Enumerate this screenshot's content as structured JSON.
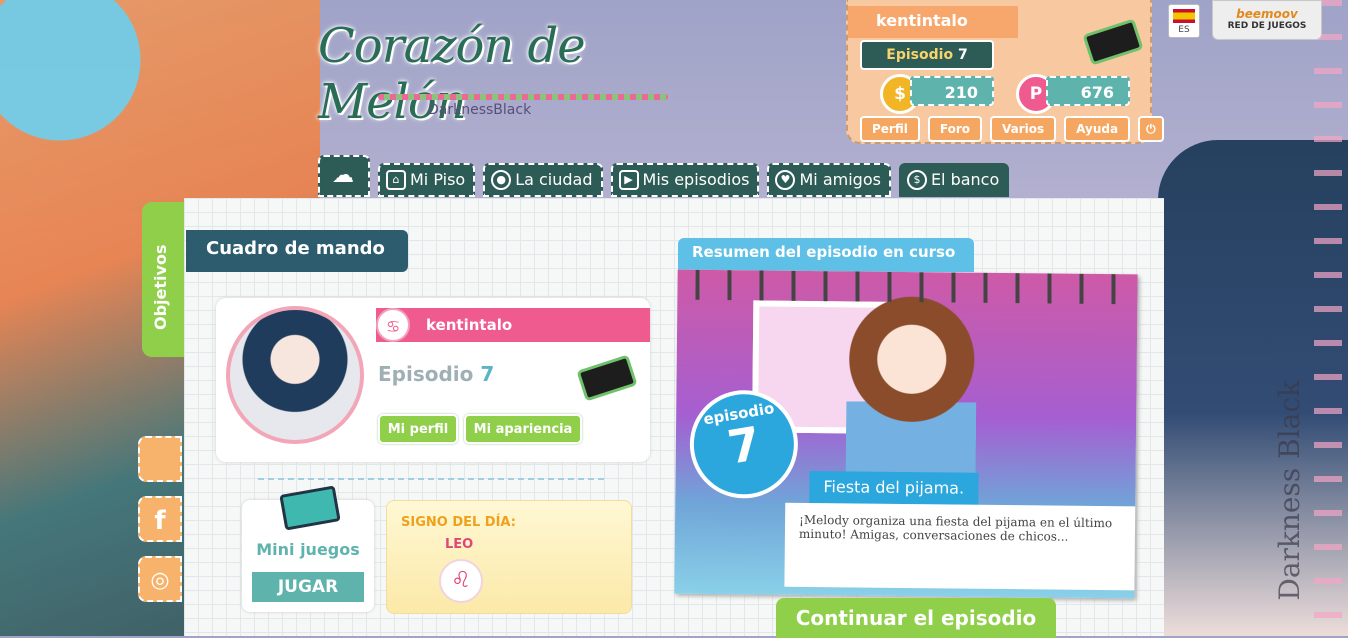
{
  "logo": {
    "title": "Corazón de Melón",
    "subtitle": "DarknessBlack"
  },
  "player": {
    "name": "kentintalo",
    "episode_label": "Episodio",
    "episode_number": "7",
    "coins": "210",
    "pa": "676",
    "links": [
      "Perfil",
      "Foro",
      "Varios",
      "Ayuda"
    ],
    "power_icon": "power-icon"
  },
  "lang": {
    "code": "ES"
  },
  "beemoov": {
    "brand": "beemoov",
    "subtitle": "RED DE JUEGOS"
  },
  "nav": {
    "tabs": [
      {
        "label": "Mi Piso",
        "icon": "house-icon"
      },
      {
        "label": "La ciudad",
        "icon": "location-icon"
      },
      {
        "label": "Mis episodios",
        "icon": "play-icon"
      },
      {
        "label": "Mi amigos",
        "icon": "heart-icon"
      },
      {
        "label": "El banco",
        "icon": "dollar-icon"
      }
    ]
  },
  "side": {
    "objetivos": "Objetivos"
  },
  "dashboard": {
    "title": "Cuadro de mando",
    "card": {
      "name": "kentintalo",
      "episode_label": "Episodio",
      "episode_number": "7",
      "btn_profile": "Mi perfil",
      "btn_appearance": "Mi apariencia"
    },
    "mini": {
      "title": "Mini juegos",
      "button": "JUGAR"
    },
    "sign": {
      "title": "SIGNO DEL DÍA:",
      "name": "LEO"
    }
  },
  "episode": {
    "header": "Resumen del episodio en curso",
    "badge_word": "episodio",
    "badge_number": "7",
    "name": "Fiesta del pijama.",
    "description": "¡Melody organiza una fiesta del pijama en el último minuto! Amigas, conversaciones de chicos...",
    "continue": "Continuar el episodio"
  },
  "watermark": "Darkness Black",
  "colors": {
    "teal": "#2d5c57",
    "orange": "#f5a761",
    "green": "#8fcf4a",
    "pink": "#f05b8f",
    "blue": "#2ba7dd"
  }
}
